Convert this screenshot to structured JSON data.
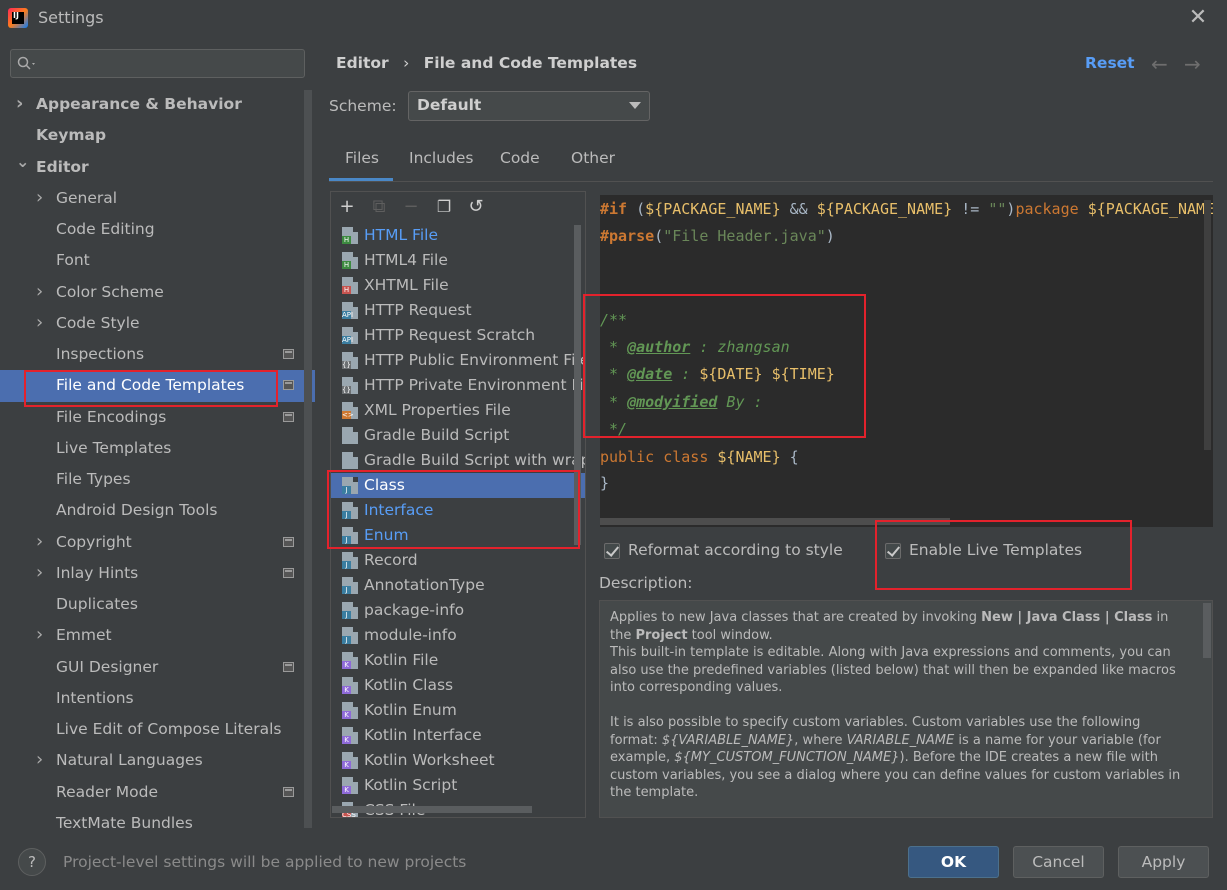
{
  "window": {
    "title": "Settings",
    "close": "✕"
  },
  "search": {
    "placeholder": ""
  },
  "sidebar": {
    "items": [
      {
        "label": "Appearance & Behavior",
        "chevron": true,
        "bold": true
      },
      {
        "label": "Keymap",
        "bold": true
      },
      {
        "label": "Editor",
        "chevron": "open",
        "bold": true
      },
      {
        "label": "General",
        "chevron": true
      },
      {
        "label": "Code Editing"
      },
      {
        "label": "Font"
      },
      {
        "label": "Color Scheme",
        "chevron": true
      },
      {
        "label": "Code Style",
        "chevron": true
      },
      {
        "label": "Inspections",
        "project_icon": true
      },
      {
        "label": "File and Code Templates",
        "selected": true,
        "project_icon": true
      },
      {
        "label": "File Encodings",
        "project_icon": true
      },
      {
        "label": "Live Templates"
      },
      {
        "label": "File Types"
      },
      {
        "label": "Android Design Tools"
      },
      {
        "label": "Copyright",
        "chevron": true,
        "project_icon": true
      },
      {
        "label": "Inlay Hints",
        "chevron": true,
        "project_icon": true
      },
      {
        "label": "Duplicates"
      },
      {
        "label": "Emmet",
        "chevron": true
      },
      {
        "label": "GUI Designer",
        "project_icon": true
      },
      {
        "label": "Intentions"
      },
      {
        "label": "Live Edit of Compose Literals"
      },
      {
        "label": "Natural Languages",
        "chevron": true
      },
      {
        "label": "Reader Mode",
        "project_icon": true
      },
      {
        "label": "TextMate Bundles"
      }
    ]
  },
  "header": {
    "crumb1": "Editor",
    "sep": "›",
    "crumb2": "File and Code Templates",
    "reset": "Reset",
    "back": "←",
    "forward": "→"
  },
  "scheme": {
    "label": "Scheme:",
    "value": "Default"
  },
  "tabs": [
    {
      "label": "Files",
      "active": true
    },
    {
      "label": "Includes"
    },
    {
      "label": "Code"
    },
    {
      "label": "Other"
    }
  ],
  "toolbar": {
    "add": "+",
    "copy_disabled": "⧉",
    "remove": "−",
    "duplicate": "❐",
    "reset": "↺"
  },
  "files": [
    {
      "label": "HTML File",
      "icon": "html-icon",
      "color": "#589df6",
      "badge": "H",
      "badge_color": "#3d8b40"
    },
    {
      "label": "HTML4 File",
      "icon": "html-icon",
      "badge": "H",
      "badge_color": "#3d8b40"
    },
    {
      "label": "XHTML File",
      "icon": "html-icon",
      "badge": "H",
      "badge_color": "#c75450"
    },
    {
      "label": "HTTP Request",
      "icon": "api-icon",
      "badge": "API",
      "badge_color": "#3b7ea1"
    },
    {
      "label": "HTTP Request Scratch",
      "icon": "api-icon",
      "badge": "API",
      "badge_color": "#3b7ea1"
    },
    {
      "label": "HTTP Public Environment File",
      "icon": "env-icon",
      "badge": "{}",
      "badge_color": "#6c7073"
    },
    {
      "label": "HTTP Private Environment File",
      "icon": "env-icon",
      "badge": "{}",
      "badge_color": "#6c7073"
    },
    {
      "label": "XML Properties File",
      "icon": "xml-icon",
      "badge": "<>",
      "badge_color": "#cc7832"
    },
    {
      "label": "Gradle Build Script",
      "icon": "gradle-icon",
      "badge": "",
      "badge_color": "#9aa7b0"
    },
    {
      "label": "Gradle Build Script with wrapp",
      "icon": "gradle-icon",
      "badge": "",
      "badge_color": "#9aa7b0"
    },
    {
      "label": "Class",
      "icon": "java-icon",
      "selected": true,
      "badge": "J",
      "badge_color": "#3b7ea1"
    },
    {
      "label": "Interface",
      "icon": "java-icon",
      "color": "#589df6",
      "badge": "J",
      "badge_color": "#3b7ea1"
    },
    {
      "label": "Enum",
      "icon": "java-icon",
      "color": "#589df6",
      "badge": "J",
      "badge_color": "#3b7ea1"
    },
    {
      "label": "Record",
      "icon": "java-icon",
      "badge": "J",
      "badge_color": "#3b7ea1"
    },
    {
      "label": "AnnotationType",
      "icon": "java-icon",
      "badge": "J",
      "badge_color": "#3b7ea1"
    },
    {
      "label": "package-info",
      "icon": "java-icon",
      "badge": "J",
      "badge_color": "#3b7ea1"
    },
    {
      "label": "module-info",
      "icon": "java-icon",
      "badge": "J",
      "badge_color": "#3b7ea1"
    },
    {
      "label": "Kotlin File",
      "icon": "kotlin-icon",
      "badge": "K",
      "badge_color": "#8e6ad8"
    },
    {
      "label": "Kotlin Class",
      "icon": "kotlin-icon",
      "badge": "K",
      "badge_color": "#8e6ad8"
    },
    {
      "label": "Kotlin Enum",
      "icon": "kotlin-icon",
      "badge": "K",
      "badge_color": "#8e6ad8"
    },
    {
      "label": "Kotlin Interface",
      "icon": "kotlin-icon",
      "badge": "K",
      "badge_color": "#8e6ad8"
    },
    {
      "label": "Kotlin Worksheet",
      "icon": "kotlin-icon",
      "badge": "K",
      "badge_color": "#8e6ad8"
    },
    {
      "label": "Kotlin Script",
      "icon": "kotlin-icon",
      "badge": "K",
      "badge_color": "#8e6ad8"
    },
    {
      "label": "CSS File",
      "icon": "css-icon",
      "badge": "CSS",
      "badge_color": "#c75450"
    }
  ],
  "editor": {
    "line1": {
      "a": "#if",
      "b": " (",
      "c": "${PACKAGE_NAME}",
      "d": " && ",
      "e": "${PACKAGE_NAME}",
      "f": " != ",
      "g": "\"\"",
      "h": ")",
      "i": "package",
      "j": " ",
      "k": "${PACKAGE_NAME}"
    },
    "line2": {
      "a": "#parse",
      "b": "(",
      "c": "\"File Header.java\"",
      "d": ")"
    },
    "c1": "/**",
    "c2": {
      "a": " * ",
      "tag": "@author",
      "b": " : zhangsan"
    },
    "c3": {
      "a": " * ",
      "tag": "@date",
      "b": " : ",
      "v1": "${DATE}",
      "sp": " ",
      "v2": "${TIME}"
    },
    "c4": {
      "a": " * ",
      "tag": "@modyified",
      "b": " By :"
    },
    "c5": " */",
    "l6": {
      "a": "public",
      "b": " ",
      "c": "class",
      "d": " ",
      "e": "${NAME}",
      "f": " {"
    },
    "l7": "}"
  },
  "options": {
    "reformat": "Reformat according to style",
    "reformat_checked": true,
    "live": "Enable Live Templates",
    "live_checked": true
  },
  "description": {
    "label": "Description:",
    "p1a": "Applies to new Java classes that are created by invoking ",
    "p1b": "New | Java Class | Class",
    "p1c": " in the ",
    "p1d": "Project",
    "p1e": " tool window.",
    "p2": "This built-in template is editable. Along with Java expressions and comments, you can also use the predefined variables (listed below) that will then be expanded like macros into corresponding values.",
    "p3a": "It is also possible to specify custom variables. Custom variables use the following format: ",
    "p3b": "${VARIABLE_NAME}",
    "p3c": ", where ",
    "p3d": "VARIABLE_NAME",
    "p3e": " is a name for your variable (for example, ",
    "p3f": "${MY_CUSTOM_FUNCTION_NAME}",
    "p3g": "). Before the IDE creates a new file with custom variables, you see a dialog where you can define values for custom variables in the template."
  },
  "footer": {
    "help": "?",
    "hint": "Project-level settings will be applied to new projects",
    "ok": "OK",
    "cancel": "Cancel",
    "apply": "Apply"
  },
  "colors": {
    "selection": "#4b6eaf",
    "link": "#589df6",
    "annotation_box": "#e3222c",
    "ok_button": "#365880"
  }
}
